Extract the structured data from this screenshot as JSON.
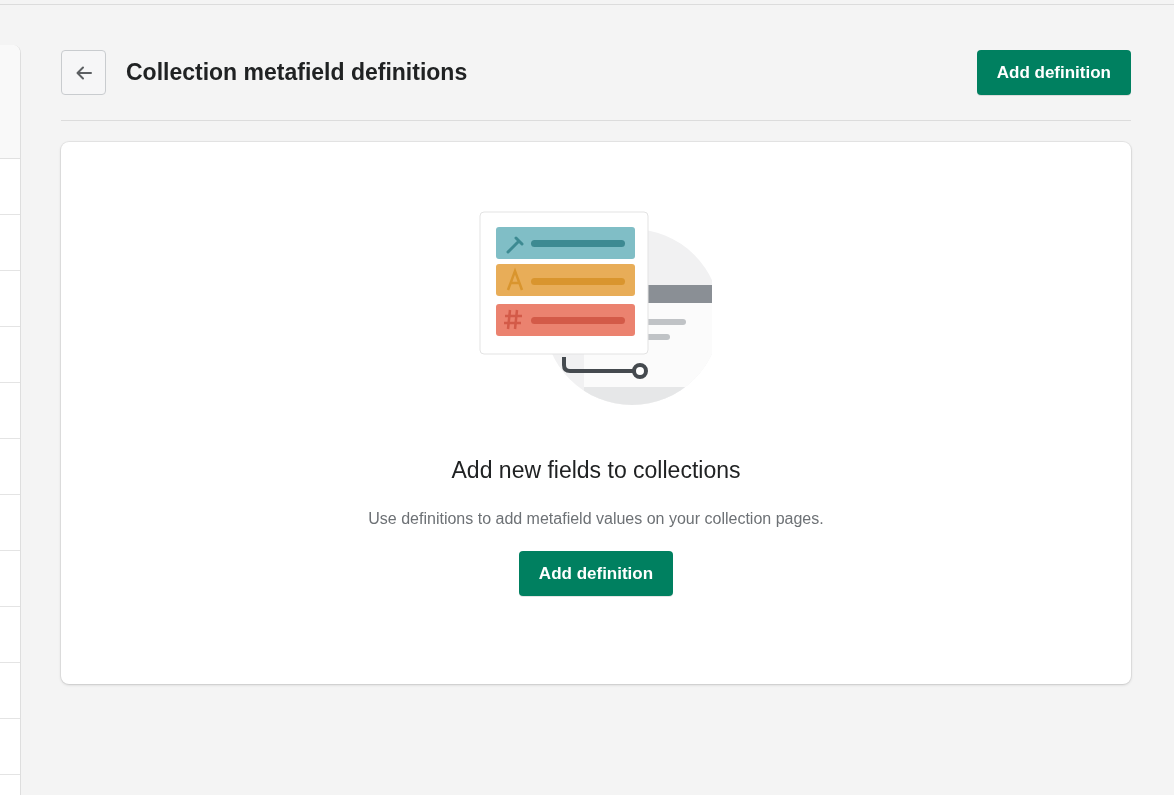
{
  "header": {
    "title": "Collection metafield definitions",
    "primary_action": "Add definition"
  },
  "empty_state": {
    "heading": "Add new fields to collections",
    "description": "Use definitions to add metafield values on your collection pages.",
    "action": "Add definition"
  }
}
